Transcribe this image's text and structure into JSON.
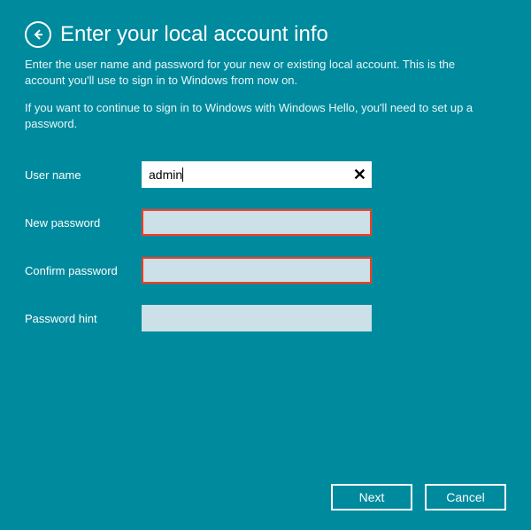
{
  "header": {
    "title": "Enter your local account info"
  },
  "description": {
    "p1": "Enter the user name and password for your new or existing local account. This is the account you'll use to sign in to Windows from now on.",
    "p2": "If you want to continue to sign in to Windows with Windows Hello, you'll need to set up a password."
  },
  "form": {
    "username_label": "User name",
    "username_value": "admin",
    "clear_glyph": "✕",
    "new_password_label": "New password",
    "confirm_password_label": "Confirm password",
    "password_hint_label": "Password hint"
  },
  "footer": {
    "next_label": "Next",
    "cancel_label": "Cancel"
  }
}
